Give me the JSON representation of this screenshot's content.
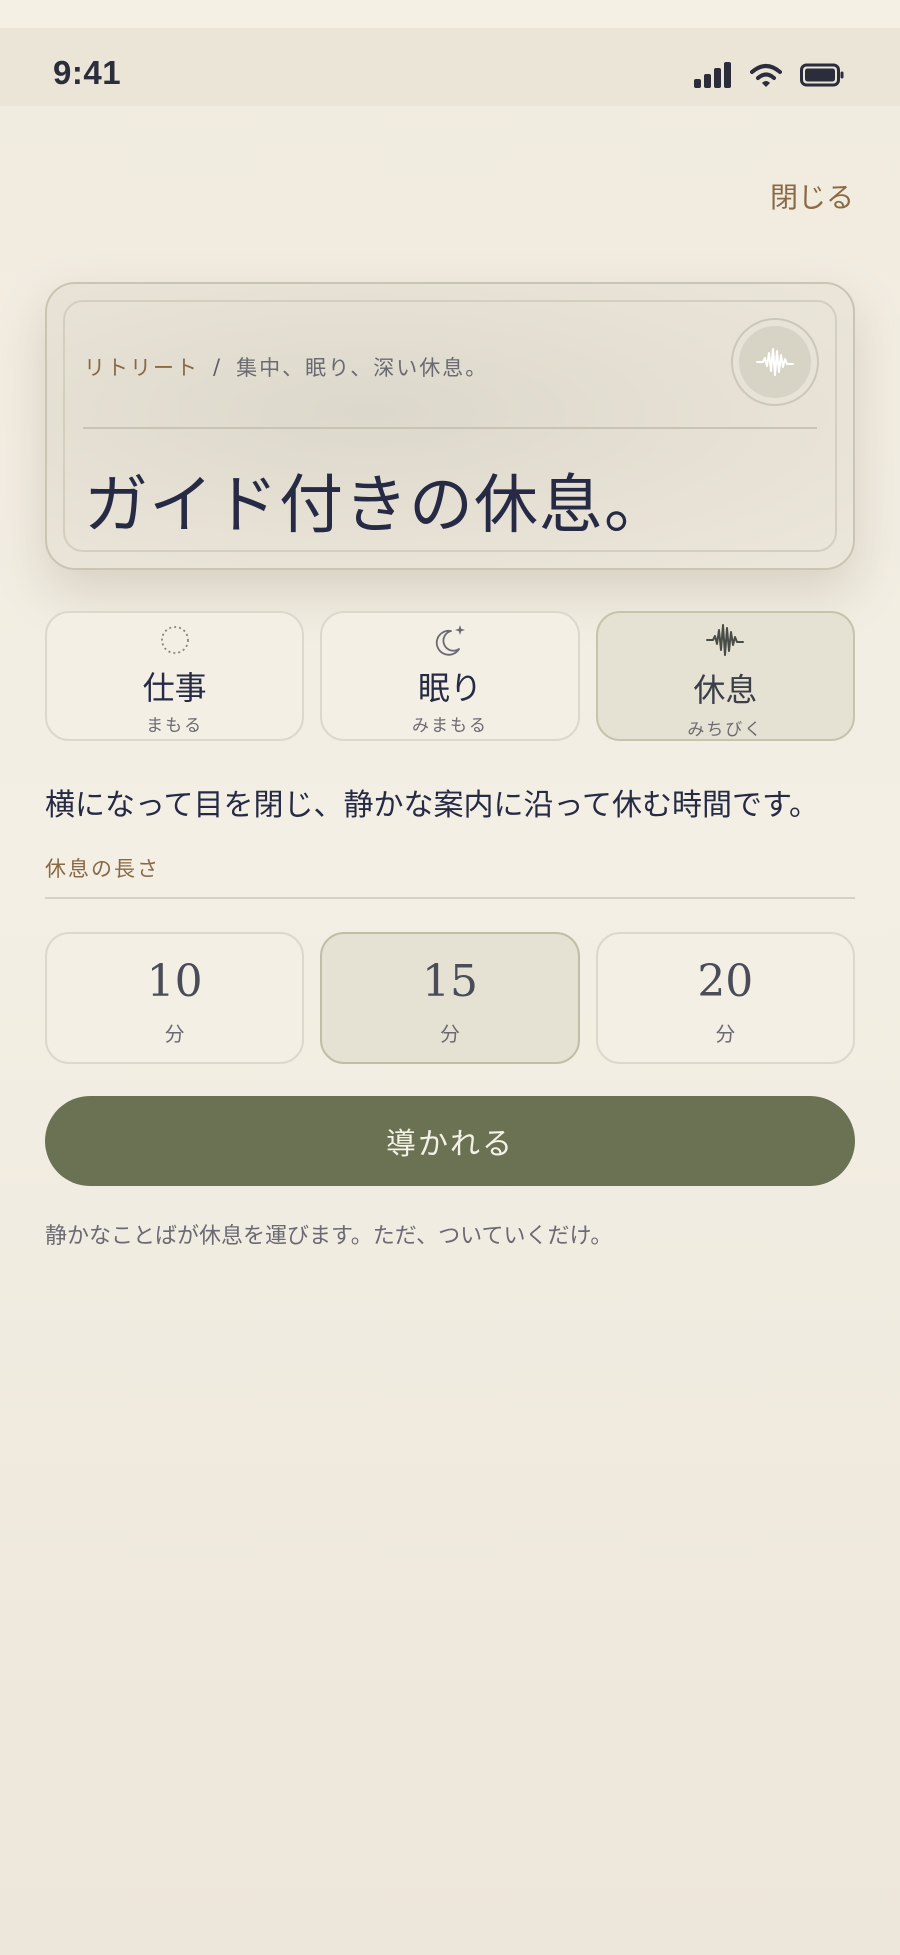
{
  "status_bar": {
    "time": "9:41"
  },
  "header": {
    "close_label": "閉じる"
  },
  "hero": {
    "breadcrumb_section": "リトリート",
    "breadcrumb_separator": "/",
    "breadcrumb_tagline": "集中、眠り、深い休息。",
    "title": "ガイド付きの休息。",
    "sound_icon": "waveform-icon"
  },
  "modes": [
    {
      "label": "仕事",
      "sub": "まもる",
      "icon": "dotted-circle-icon",
      "selected": false
    },
    {
      "label": "眠り",
      "sub": "みまもる",
      "icon": "moon-sparkle-icon",
      "selected": false
    },
    {
      "label": "休息",
      "sub": "みちびく",
      "icon": "waveform-icon",
      "selected": true
    }
  ],
  "description": "横になって目を閉じ、静かな案内に沿って休む時間です。",
  "duration": {
    "label": "休息の長さ",
    "options": [
      {
        "value": "10",
        "unit": "分",
        "selected": false
      },
      {
        "value": "15",
        "unit": "分",
        "selected": true
      },
      {
        "value": "20",
        "unit": "分",
        "selected": false
      }
    ]
  },
  "cta_label": "導かれる",
  "footnote": "静かなことばが休息を運びます。ただ、ついていくだけ。",
  "colors": {
    "accent_brown": "#8a6a45",
    "button_olive": "#6b7253",
    "ink": "#262a45",
    "background": "#f3efe4"
  }
}
